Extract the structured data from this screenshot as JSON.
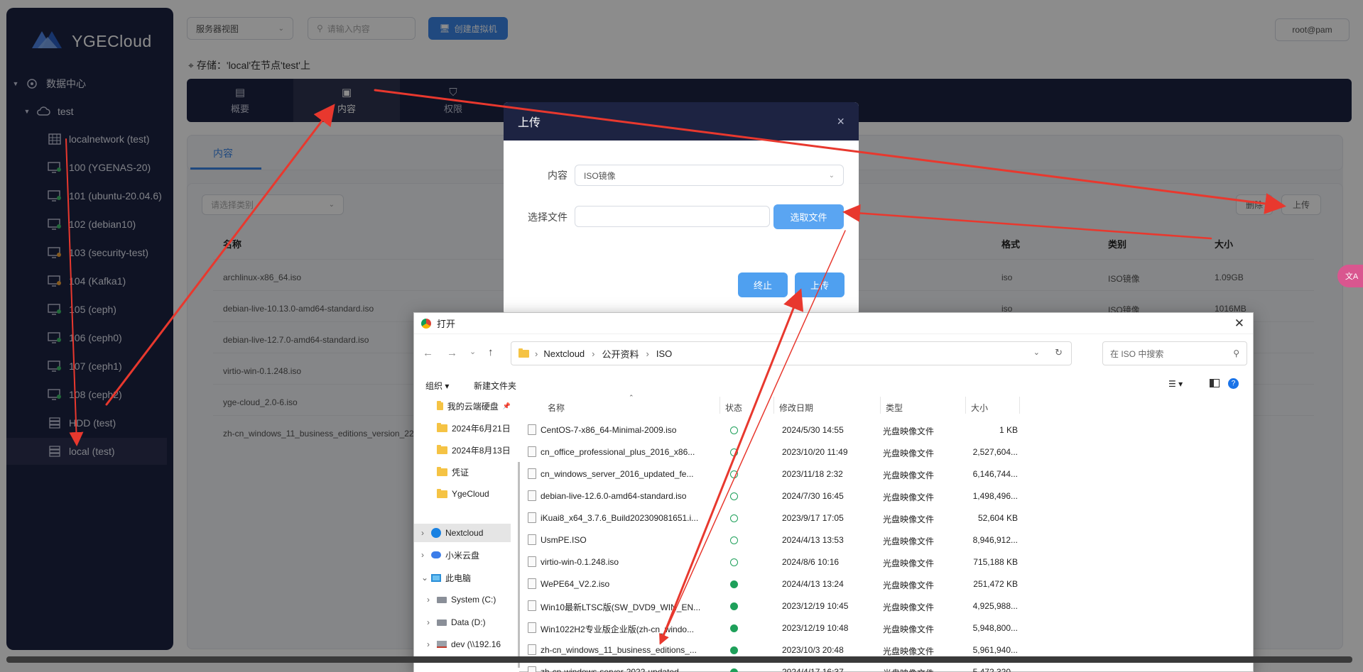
{
  "app": {
    "brand": "YGECloud"
  },
  "topbar": {
    "view_select": "服务器视图",
    "search_placeholder": "请输入内容",
    "create_vm": "创建虚拟机",
    "user": "root@pam"
  },
  "storage_line": "存储：'local'在节点'test'上",
  "sidebar": {
    "datacenter": "数据中心",
    "node": "test",
    "items": [
      {
        "label": "localnetwork (test)",
        "icon": "network-icon"
      },
      {
        "label": "100 (YGENAS-20)",
        "icon": "vm-icon"
      },
      {
        "label": "101 (ubuntu-20.04.6)",
        "icon": "vm-icon"
      },
      {
        "label": "102 (debian10)",
        "icon": "vm-icon"
      },
      {
        "label": "103 (security-test)",
        "icon": "vm-icon"
      },
      {
        "label": "104 (Kafka1)",
        "icon": "vm-icon"
      },
      {
        "label": "105 (ceph)",
        "icon": "vm-icon"
      },
      {
        "label": "106 (ceph0)",
        "icon": "vm-icon"
      },
      {
        "label": "107 (ceph1)",
        "icon": "vm-icon"
      },
      {
        "label": "108 (ceph2)",
        "icon": "vm-icon"
      },
      {
        "label": "HDD (test)",
        "icon": "storage-icon"
      },
      {
        "label": "local (test)",
        "icon": "storage-icon"
      }
    ]
  },
  "tabs": [
    {
      "label": "概要"
    },
    {
      "label": "内容"
    },
    {
      "label": "权限"
    }
  ],
  "content": {
    "subtab": "内容",
    "filter_placeholder": "请选择类别",
    "delete_btn": "删除",
    "upload_btn": "上传",
    "columns": {
      "name": "名称",
      "format": "格式",
      "type": "类别",
      "size": "大小"
    },
    "rows": [
      {
        "name": "archlinux-x86_64.iso",
        "format": "iso",
        "type": "ISO镜像",
        "size": "1.09GB"
      },
      {
        "name": "debian-live-10.13.0-amd64-standard.iso",
        "format": "iso",
        "type": "ISO镜像",
        "size": "1016MB"
      },
      {
        "name": "debian-live-12.7.0-amd64-standard.iso",
        "format": "",
        "type": "",
        "size": ""
      },
      {
        "name": "virtio-win-0.1.248.iso",
        "format": "",
        "type": "",
        "size": ""
      },
      {
        "name": "yge-cloud_2.0-6.iso",
        "format": "",
        "type": "",
        "size": ""
      },
      {
        "name": "zh-cn_windows_11_business_editions_version_22h",
        "format": "",
        "type": "",
        "size": ""
      }
    ]
  },
  "modal": {
    "title": "上传",
    "content_label": "内容",
    "content_value": "ISO镜像",
    "file_label": "选择文件",
    "pick_file": "选取文件",
    "abort": "终止",
    "upload": "上传"
  },
  "file_dialog": {
    "title": "打开",
    "path": [
      "Nextcloud",
      "公开资料",
      "ISO"
    ],
    "search_placeholder": "在 ISO 中搜索",
    "organize": "组织",
    "new_folder": "新建文件夹",
    "left_tree": [
      {
        "label": "我的云端硬盘"
      },
      {
        "label": "2024年6月21日"
      },
      {
        "label": "2024年8月13日"
      },
      {
        "label": "凭证"
      },
      {
        "label": "YgeCloud"
      },
      {
        "label": "Nextcloud"
      },
      {
        "label": "小米云盘"
      },
      {
        "label": "此电脑"
      },
      {
        "label": "System (C:)"
      },
      {
        "label": "Data (D:)"
      },
      {
        "label": "dev (\\\\192.16"
      }
    ],
    "columns": {
      "name": "名称",
      "status": "状态",
      "date": "修改日期",
      "type": "类型",
      "size": "大小"
    },
    "files": [
      {
        "name": "CentOS-7-x86_64-Minimal-2009.iso",
        "status": "line",
        "date": "2024/5/30 14:55",
        "type": "光盘映像文件",
        "size": "1 KB"
      },
      {
        "name": "cn_office_professional_plus_2016_x86...",
        "status": "line",
        "date": "2023/10/20 11:49",
        "type": "光盘映像文件",
        "size": "2,527,604..."
      },
      {
        "name": "cn_windows_server_2016_updated_fe...",
        "status": "line",
        "date": "2023/11/18 2:32",
        "type": "光盘映像文件",
        "size": "6,146,744..."
      },
      {
        "name": "debian-live-12.6.0-amd64-standard.iso",
        "status": "line",
        "date": "2024/7/30 16:45",
        "type": "光盘映像文件",
        "size": "1,498,496..."
      },
      {
        "name": "iKuai8_x64_3.7.6_Build202309081651.i...",
        "status": "line",
        "date": "2023/9/17 17:05",
        "type": "光盘映像文件",
        "size": "52,604 KB"
      },
      {
        "name": "UsmPE.ISO",
        "status": "line",
        "date": "2024/4/13 13:53",
        "type": "光盘映像文件",
        "size": "8,946,912..."
      },
      {
        "name": "virtio-win-0.1.248.iso",
        "status": "line",
        "date": "2024/8/6 10:16",
        "type": "光盘映像文件",
        "size": "715,188 KB"
      },
      {
        "name": "WePE64_V2.2.iso",
        "status": "fill",
        "date": "2024/4/13 13:24",
        "type": "光盘映像文件",
        "size": "251,472 KB"
      },
      {
        "name": "Win10最新LTSC版(SW_DVD9_WIN_EN...",
        "status": "fill",
        "date": "2023/12/19 10:45",
        "type": "光盘映像文件",
        "size": "4,925,988..."
      },
      {
        "name": "Win1022H2专业版企业版(zh-cn_windo...",
        "status": "fill",
        "date": "2023/12/19 10:48",
        "type": "光盘映像文件",
        "size": "5,948,800..."
      },
      {
        "name": "zh-cn_windows_11_business_editions_...",
        "status": "fill",
        "date": "2023/10/3 20:48",
        "type": "光盘映像文件",
        "size": "5,961,940..."
      },
      {
        "name": "zh-cn-windows-server-2022-updated...",
        "status": "fill",
        "date": "2024/4/17 16:37",
        "type": "光盘映像文件",
        "size": "5,472,320..."
      }
    ]
  },
  "side_badge": "文A",
  "colors": {
    "sidebar": "#1d2342",
    "accent": "#3b86e8",
    "annotation": "#e8382e"
  }
}
